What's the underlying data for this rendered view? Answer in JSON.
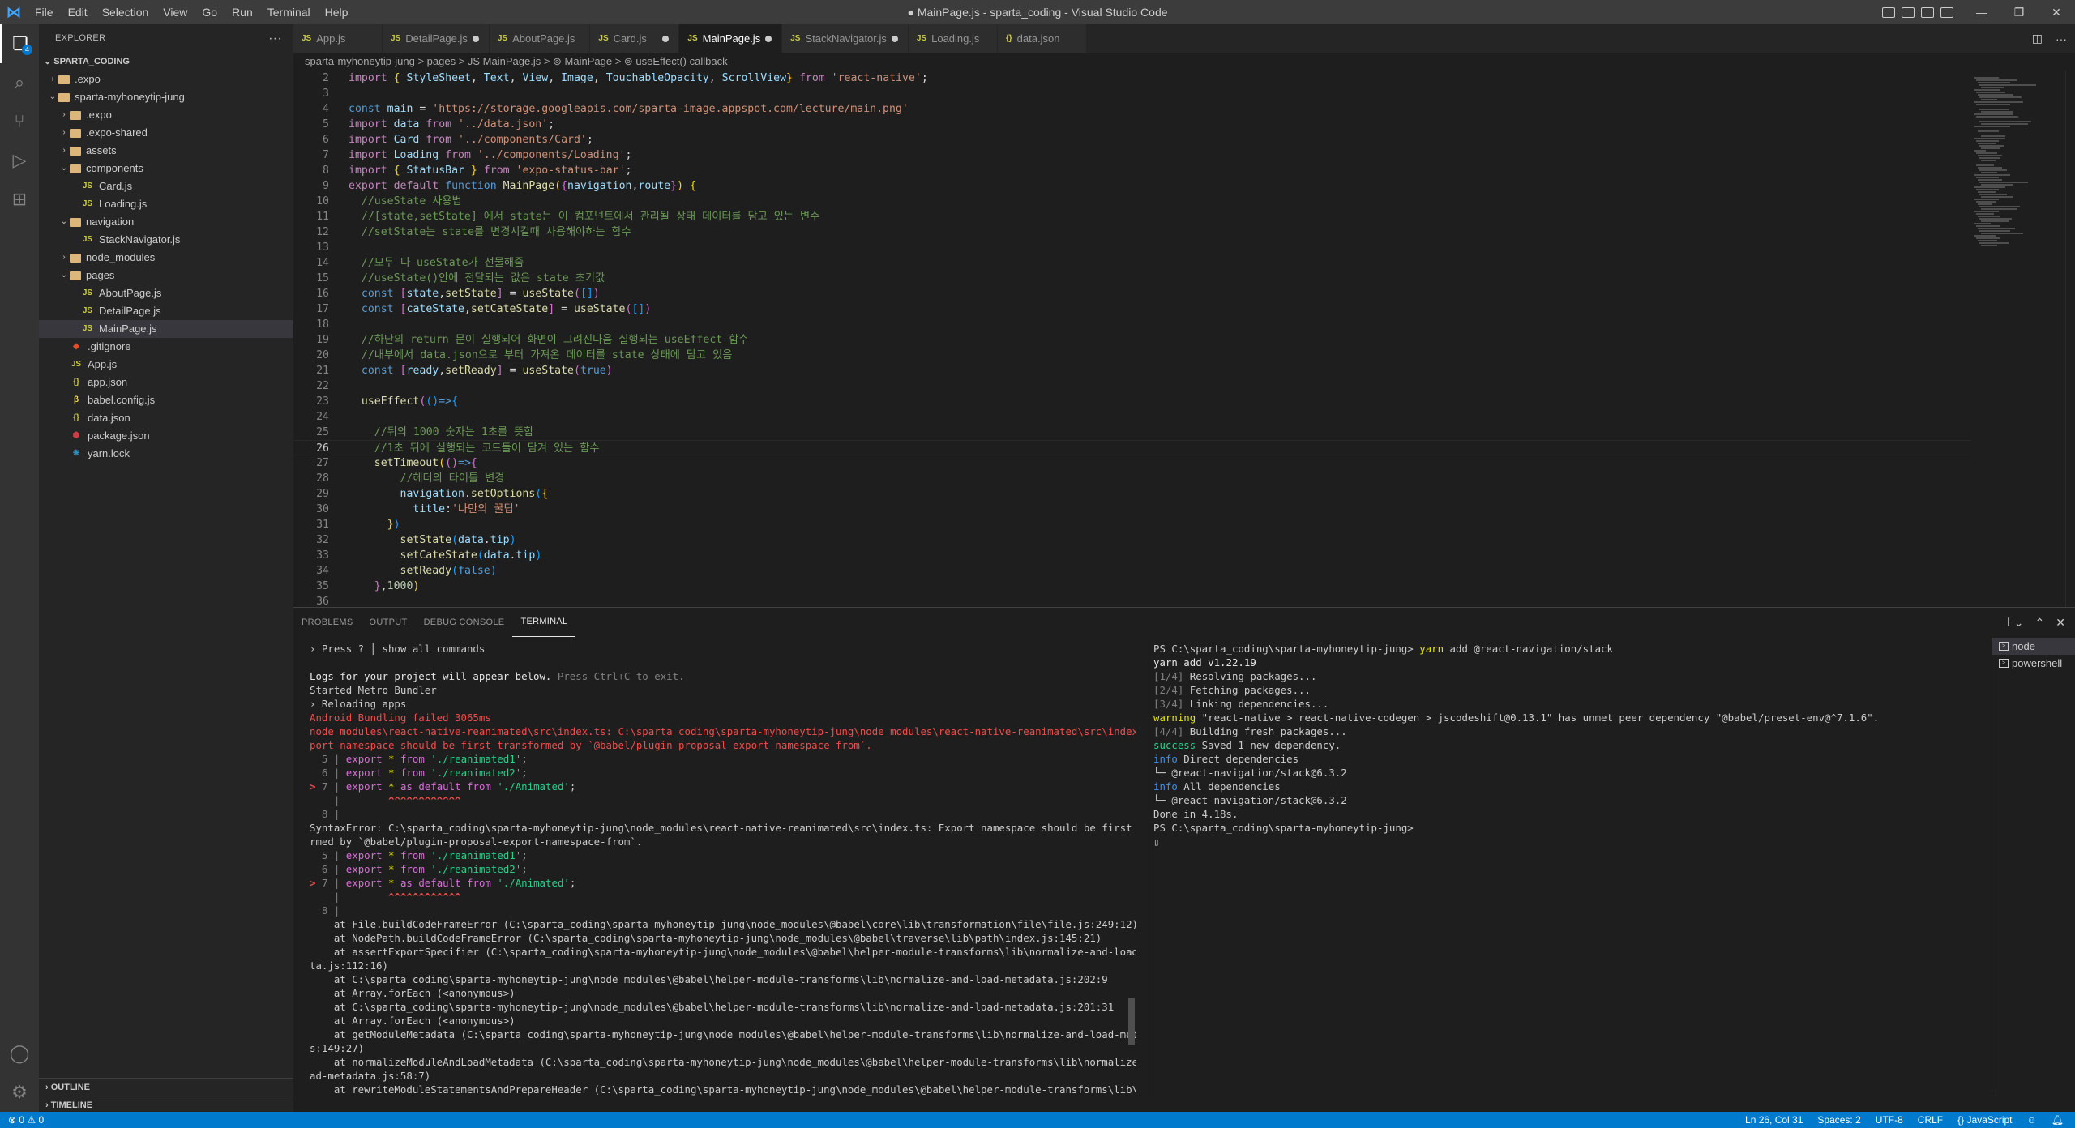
{
  "window": {
    "title": "● MainPage.js - sparta_coding - Visual Studio Code",
    "menus": [
      "File",
      "Edit",
      "Selection",
      "View",
      "Go",
      "Run",
      "Terminal",
      "Help"
    ]
  },
  "activity_bar": {
    "explorer_badge": "4"
  },
  "sidebar": {
    "header": "EXPLORER",
    "root": "SPARTA_CODING",
    "outline": "OUTLINE",
    "timeline": "TIMELINE",
    "tree": [
      {
        "label": ".expo",
        "kind": "folder",
        "depth": 1,
        "open": false
      },
      {
        "label": "sparta-myhoneytip-jung",
        "kind": "folder",
        "depth": 1,
        "open": true
      },
      {
        "label": ".expo",
        "kind": "folder",
        "depth": 2,
        "open": false
      },
      {
        "label": ".expo-shared",
        "kind": "folder",
        "depth": 2,
        "open": false
      },
      {
        "label": "assets",
        "kind": "folder",
        "depth": 2,
        "open": false
      },
      {
        "label": "components",
        "kind": "folder",
        "depth": 2,
        "open": true
      },
      {
        "label": "Card.js",
        "kind": "js",
        "depth": 3
      },
      {
        "label": "Loading.js",
        "kind": "js",
        "depth": 3
      },
      {
        "label": "navigation",
        "kind": "folder",
        "depth": 2,
        "open": true
      },
      {
        "label": "StackNavigator.js",
        "kind": "js",
        "depth": 3
      },
      {
        "label": "node_modules",
        "kind": "folder",
        "depth": 2,
        "open": false
      },
      {
        "label": "pages",
        "kind": "folder",
        "depth": 2,
        "open": true
      },
      {
        "label": "AboutPage.js",
        "kind": "js",
        "depth": 3
      },
      {
        "label": "DetailPage.js",
        "kind": "js",
        "depth": 3
      },
      {
        "label": "MainPage.js",
        "kind": "js",
        "depth": 3,
        "selected": true
      },
      {
        "label": ".gitignore",
        "kind": "git",
        "depth": 2
      },
      {
        "label": "App.js",
        "kind": "js",
        "depth": 2
      },
      {
        "label": "app.json",
        "kind": "json",
        "depth": 2
      },
      {
        "label": "babel.config.js",
        "kind": "babel",
        "depth": 2
      },
      {
        "label": "data.json",
        "kind": "json",
        "depth": 2
      },
      {
        "label": "package.json",
        "kind": "pkg",
        "depth": 2
      },
      {
        "label": "yarn.lock",
        "kind": "yarn",
        "depth": 2
      }
    ]
  },
  "tabs": [
    {
      "label": "App.js",
      "icon": "JS",
      "modified": false
    },
    {
      "label": "DetailPage.js",
      "icon": "JS",
      "modified": true
    },
    {
      "label": "AboutPage.js",
      "icon": "JS",
      "modified": false
    },
    {
      "label": "Card.js",
      "icon": "JS",
      "modified": true
    },
    {
      "label": "MainPage.js",
      "icon": "JS",
      "modified": true,
      "active": true
    },
    {
      "label": "StackNavigator.js",
      "icon": "JS",
      "modified": true
    },
    {
      "label": "Loading.js",
      "icon": "JS",
      "modified": false
    },
    {
      "label": "data.json",
      "icon": "{}",
      "modified": false
    }
  ],
  "breadcrumb": "sparta-myhoneytip-jung  >  pages  >  JS MainPage.js  >  ⊚ MainPage  >  ⊚ useEffect() callback",
  "editor": {
    "current_line": 26,
    "lines": [
      {
        "n": "2",
        "html": "<span class='k'>import</span> <span class='p'>{</span> <span class='v'>StyleSheet</span>, <span class='v'>Text</span>, <span class='v'>View</span>, <span class='v'>Image</span>, <span class='v'>TouchableOpacity</span>, <span class='v'>ScrollView</span><span class='p'>}</span> <span class='k'>from</span> <span class='s'>'react-native'</span>;"
      },
      {
        "n": "3",
        "html": ""
      },
      {
        "n": "4",
        "html": "<span class='b'>const</span> <span class='v'>main</span> = <span class='s'>'<span class='u'>https://storage.googleapis.com/sparta-image.appspot.com/lecture/main.png</span>'</span>"
      },
      {
        "n": "5",
        "html": "<span class='k'>import</span> <span class='v'>data</span> <span class='k'>from</span> <span class='s'>'../data.json'</span>;"
      },
      {
        "n": "6",
        "html": "<span class='k'>import</span> <span class='v'>Card</span> <span class='k'>from</span> <span class='s'>'../components/Card'</span>;"
      },
      {
        "n": "7",
        "html": "<span class='k'>import</span> <span class='v'>Loading</span> <span class='k'>from</span> <span class='s'>'../components/Loading'</span>;"
      },
      {
        "n": "8",
        "html": "<span class='k'>import</span> <span class='p'>{</span> <span class='v'>StatusBar</span> <span class='p'>}</span> <span class='k'>from</span> <span class='s'>'expo-status-bar'</span>;"
      },
      {
        "n": "9",
        "html": "<span class='k'>export</span> <span class='k'>default</span> <span class='b'>function</span> <span class='f'>MainPage</span><span class='p'>(</span><span class='p2'>{</span><span class='v'>navigation</span>,<span class='v'>route</span><span class='p2'>}</span><span class='p'>)</span> <span class='p'>{</span>"
      },
      {
        "n": "10",
        "html": "  <span class='c'>//useState 사용법</span>"
      },
      {
        "n": "11",
        "html": "  <span class='c'>//[state,setState] 에서 state는 이 컴포넌트에서 관리될 상태 데이터를 담고 있는 변수</span>"
      },
      {
        "n": "12",
        "html": "  <span class='c'>//setState는 state를 변경시킬때 사용해야하는 함수</span>"
      },
      {
        "n": "13",
        "html": ""
      },
      {
        "n": "14",
        "html": "  <span class='c'>//모두 다 useState가 선물해줌</span>"
      },
      {
        "n": "15",
        "html": "  <span class='c'>//useState()안에 전달되는 값은 state 초기값</span>"
      },
      {
        "n": "16",
        "html": "  <span class='b'>const</span> <span class='p2'>[</span><span class='v'>state</span>,<span class='f'>setState</span><span class='p2'>]</span> = <span class='f'>useState</span><span class='p2'>(</span><span class='p3'>[]</span><span class='p2'>)</span>"
      },
      {
        "n": "17",
        "html": "  <span class='b'>const</span> <span class='p2'>[</span><span class='v'>cateState</span>,<span class='f'>setCateState</span><span class='p2'>]</span> = <span class='f'>useState</span><span class='p2'>(</span><span class='p3'>[]</span><span class='p2'>)</span>"
      },
      {
        "n": "18",
        "html": ""
      },
      {
        "n": "19",
        "html": "  <span class='c'>//하단의 return 문이 실행되어 화면이 그려진다음 실행되는 useEffect 함수</span>"
      },
      {
        "n": "20",
        "html": "  <span class='c'>//내부에서 data.json으로 부터 가져온 데이터를 state 상태에 담고 있음</span>"
      },
      {
        "n": "21",
        "html": "  <span class='b'>const</span> <span class='p2'>[</span><span class='v'>ready</span>,<span class='f'>setReady</span><span class='p2'>]</span> = <span class='f'>useState</span><span class='p2'>(</span><span class='b'>true</span><span class='p2'>)</span>"
      },
      {
        "n": "22",
        "html": ""
      },
      {
        "n": "23",
        "html": "  <span class='f'>useEffect</span><span class='p2'>(</span><span class='p3'>()</span><span class='b'>=&gt;</span><span class='p3'>{</span>"
      },
      {
        "n": "24",
        "html": ""
      },
      {
        "n": "25",
        "html": "    <span class='c'>//뒤의 1000 숫자는 1초를 뜻함</span>"
      },
      {
        "n": "26",
        "html": "    <span class='c'>//1초 뒤에 실행되는 코드들이 담겨 있는 함수</span>"
      },
      {
        "n": "27",
        "html": "    <span class='f'>setTimeout</span><span class='p'>(</span><span class='p2'>()</span><span class='b'>=&gt;</span><span class='p2'>{</span>"
      },
      {
        "n": "28",
        "html": "        <span class='c'>//헤더의 타이틀 변경</span>"
      },
      {
        "n": "29",
        "html": "        <span class='v'>navigation</span>.<span class='f'>setOptions</span><span class='p3'>(</span><span class='p'>{</span>"
      },
      {
        "n": "30",
        "html": "          <span class='v'>title</span>:<span class='s'>'나만의 꿀팁'</span>"
      },
      {
        "n": "31",
        "html": "      <span class='p'>}</span><span class='p3'>)</span>"
      },
      {
        "n": "32",
        "html": "        <span class='f'>setState</span><span class='p3'>(</span><span class='v'>data</span>.<span class='v'>tip</span><span class='p3'>)</span>"
      },
      {
        "n": "33",
        "html": "        <span class='f'>setCateState</span><span class='p3'>(</span><span class='v'>data</span>.<span class='v'>tip</span><span class='p3'>)</span>"
      },
      {
        "n": "34",
        "html": "        <span class='f'>setReady</span><span class='p3'>(</span><span class='b'>false</span><span class='p3'>)</span>"
      },
      {
        "n": "35",
        "html": "    <span class='p2'>}</span>,<span class='n'>1000</span><span class='p'>)</span>"
      },
      {
        "n": "36",
        "html": ""
      }
    ]
  },
  "panel": {
    "tabs": [
      "PROBLEMS",
      "OUTPUT",
      "DEBUG CONSOLE",
      "TERMINAL"
    ],
    "active_tab": "TERMINAL",
    "terminals": [
      "node",
      "powershell"
    ],
    "term1": [
      "› Press ? │ show all commands",
      "",
      "<span class='wh'>Logs for your project will appear below.</span> <span class='gr'>Press Ctrl+C to exit.</span>",
      "Started Metro Bundler",
      "› Reloading apps",
      "<span class='red'>Android Bundling failed 3065ms</span>",
      "<span class='red'>node_modules\\react-native-reanimated\\src\\index.ts: C:\\sparta_coding\\sparta-myhoneytip-jung\\node_modules\\react-native-reanimated\\src\\index.ts: Ex</span>",
      "<span class='red'>port namespace should be first transformed by `@babel/plugin-proposal-export-namespace-from`.</span>",
      "<span class='gr'>  5 |</span> <span class='mag'>export</span> <span class='yel'>*</span> <span class='mag'>from</span> <span class='grn'>'./reanimated1'</span>;",
      "<span class='gr'>  6 |</span> <span class='mag'>export</span> <span class='yel'>*</span> <span class='mag'>from</span> <span class='grn'>'./reanimated2'</span>;",
      "<span class='bred'>&gt;</span> <span class='gr'>7 |</span> <span class='mag'>export</span> <span class='yel'>*</span> <span class='mag'>as default from</span> <span class='grn'>'./Animated'</span>;",
      "<span class='gr'>    |</span>        <span class='bred'>^^^^^^^^^^^^</span>",
      "<span class='gr'>  8 |</span>",
      "SyntaxError: C:\\sparta_coding\\sparta-myhoneytip-jung\\node_modules\\react-native-reanimated\\src\\index.ts: Export namespace should be first transfo",
      "rmed by `@babel/plugin-proposal-export-namespace-from`.",
      "<span class='gr'>  5 |</span> <span class='mag'>export</span> <span class='yel'>*</span> <span class='mag'>from</span> <span class='grn'>'./reanimated1'</span>;",
      "<span class='gr'>  6 |</span> <span class='mag'>export</span> <span class='yel'>*</span> <span class='mag'>from</span> <span class='grn'>'./reanimated2'</span>;",
      "<span class='bred'>&gt;</span> <span class='gr'>7 |</span> <span class='mag'>export</span> <span class='yel'>*</span> <span class='mag'>as default from</span> <span class='grn'>'./Animated'</span>;",
      "<span class='gr'>    |</span>        <span class='bred'>^^^^^^^^^^^^</span>",
      "<span class='gr'>  8 |</span>",
      "    at File.buildCodeFrameError (C:\\sparta_coding\\sparta-myhoneytip-jung\\node_modules\\@babel\\core\\lib\\transformation\\file\\file.js:249:12)",
      "    at NodePath.buildCodeFrameError (C:\\sparta_coding\\sparta-myhoneytip-jung\\node_modules\\@babel\\traverse\\lib\\path\\index.js:145:21)",
      "    at assertExportSpecifier (C:\\sparta_coding\\sparta-myhoneytip-jung\\node_modules\\@babel\\helper-module-transforms\\lib\\normalize-and-load-metada",
      "ta.js:112:16)",
      "    at C:\\sparta_coding\\sparta-myhoneytip-jung\\node_modules\\@babel\\helper-module-transforms\\lib\\normalize-and-load-metadata.js:202:9",
      "    at Array.forEach (&lt;anonymous&gt;)",
      "    at C:\\sparta_coding\\sparta-myhoneytip-jung\\node_modules\\@babel\\helper-module-transforms\\lib\\normalize-and-load-metadata.js:201:31",
      "    at Array.forEach (&lt;anonymous&gt;)",
      "    at getModuleMetadata (C:\\sparta_coding\\sparta-myhoneytip-jung\\node_modules\\@babel\\helper-module-transforms\\lib\\normalize-and-load-metadata.j",
      "s:149:27)",
      "    at normalizeModuleAndLoadMetadata (C:\\sparta_coding\\sparta-myhoneytip-jung\\node_modules\\@babel\\helper-module-transforms\\lib\\normalize-and-lo",
      "ad-metadata.js:58:7)",
      "    at rewriteModuleStatementsAndPrepareHeader (C:\\sparta_coding\\sparta-myhoneytip-jung\\node_modules\\@babel\\helper-module-transforms\\lib\\index.j",
      "s:93:54)"
    ],
    "term2": [
      "PS C:\\sparta_coding\\sparta-myhoneytip-jung&gt; <span class='yel'>yarn</span> add @react-navigation/stack",
      "<span class='wh'>yarn add v1.22.19</span>",
      "<span class='gr'>[1/4]</span> Resolving packages...",
      "<span class='gr'>[2/4]</span> Fetching packages...",
      "<span class='gr'>[3/4]</span> Linking dependencies...",
      "<span class='yel'>warning</span> \"react-native &gt; react-native-codegen &gt; jscodeshift@0.13.1\" has unmet peer dependency \"@babel/preset-env@^7.1.6\".",
      "<span class='gr'>[4/4]</span> Building fresh packages...",
      "<span class='grn'>success</span> Saved 1 new dependency.",
      "<span class='bl'>info</span> Direct dependencies",
      "└─ @react-navigation/stack@6.3.2",
      "<span class='bl'>info</span> All dependencies",
      "└─ @react-navigation/stack@6.3.2",
      "Done in 4.18s.",
      "PS C:\\sparta_coding\\sparta-myhoneytip-jung&gt;",
      "▯"
    ]
  },
  "status_bar": {
    "problems": "⊗ 0 ⚠ 0",
    "position": "Ln 26, Col 31",
    "spaces": "Spaces: 2",
    "encoding": "UTF-8",
    "eol": "CRLF",
    "language": "{} JavaScript",
    "icons": [
      "bell-icon",
      "feedback-icon"
    ]
  }
}
